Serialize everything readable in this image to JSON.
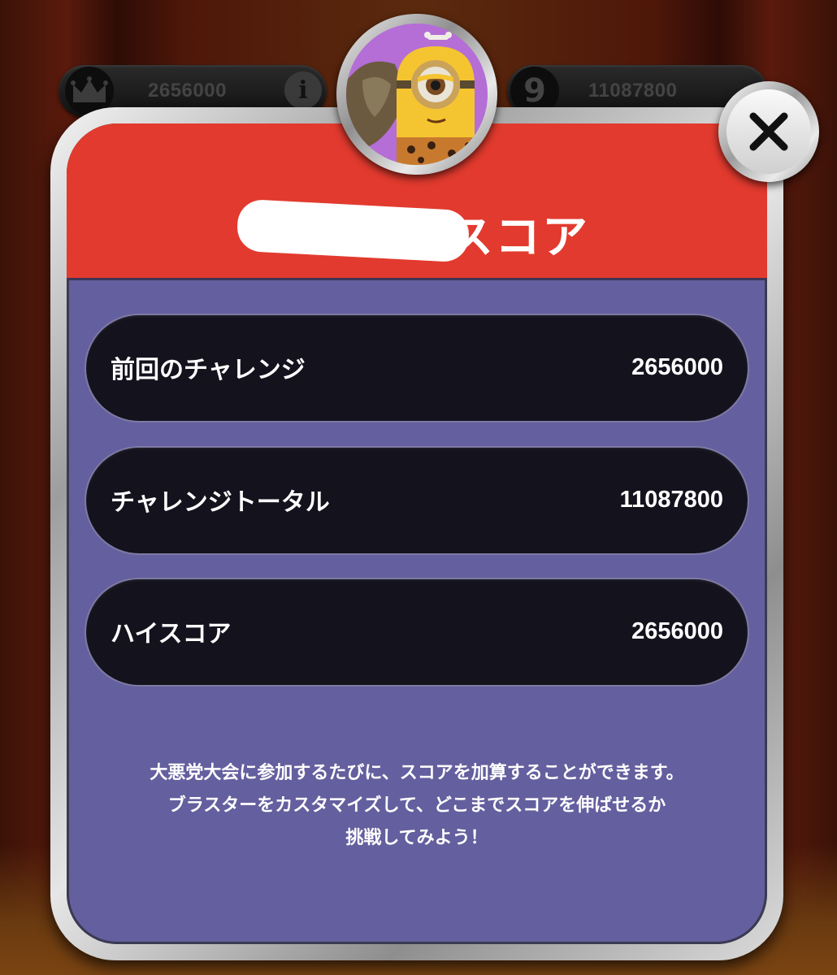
{
  "hud": {
    "high_score": "2656000",
    "round": "9",
    "total_score": "11087800",
    "info_label": "i"
  },
  "dialog": {
    "title": "スコア",
    "rows": [
      {
        "label": "前回のチャレンジ",
        "value": "2656000"
      },
      {
        "label": "チャレンジトータル",
        "value": "11087800"
      },
      {
        "label": "ハイスコア",
        "value": "2656000"
      }
    ],
    "description": [
      "大悪党大会に参加するたびに、スコアを加算することができます。",
      "ブラスターをカスタマイズして、どこまでスコアを伸ばせるか",
      "挑戦してみよう！"
    ]
  },
  "icons": {
    "crown": "crown-icon",
    "info": "info-icon",
    "close": "close-icon",
    "avatar": "minion-avatar"
  },
  "colors": {
    "header_red": "#e23a2e",
    "panel_purple": "#645f9e",
    "row_dark": "#13121d",
    "avatar_bg": "#b46ed6"
  }
}
